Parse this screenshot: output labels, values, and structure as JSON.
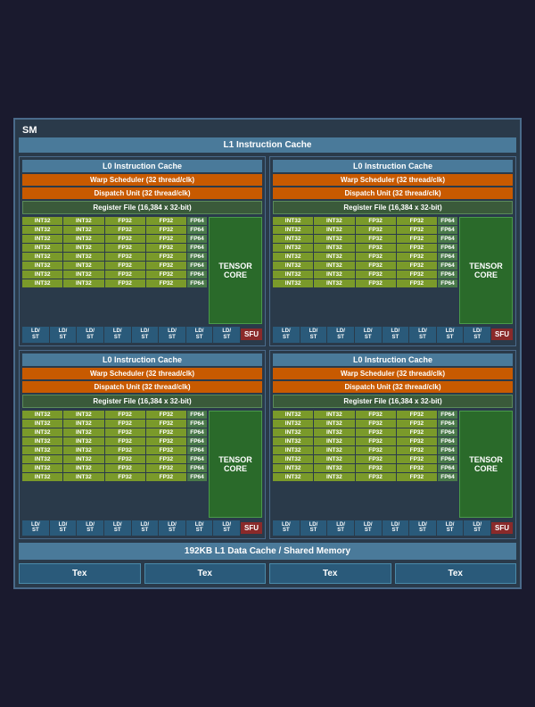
{
  "sm": {
    "label": "SM",
    "l1_instruction_cache": "L1 Instruction Cache",
    "quadrants": [
      {
        "id": "q1",
        "l0_cache": "L0 Instruction Cache",
        "warp_scheduler": "Warp Scheduler (32 thread/clk)",
        "dispatch_unit": "Dispatch Unit (32 thread/clk)",
        "register_file": "Register File (16,384 x 32-bit)",
        "tensor_core": "TENSOR CORE",
        "rows": [
          [
            "INT32",
            "INT32",
            "FP32",
            "FP32",
            "FP64"
          ],
          [
            "INT32",
            "INT32",
            "FP32",
            "FP32",
            "FP64"
          ],
          [
            "INT32",
            "INT32",
            "FP32",
            "FP32",
            "FP64"
          ],
          [
            "INT32",
            "INT32",
            "FP32",
            "FP32",
            "FP64"
          ],
          [
            "INT32",
            "INT32",
            "FP32",
            "FP32",
            "FP64"
          ],
          [
            "INT32",
            "INT32",
            "FP32",
            "FP32",
            "FP64"
          ],
          [
            "INT32",
            "INT32",
            "FP32",
            "FP32",
            "FP64"
          ],
          [
            "INT32",
            "INT32",
            "FP32",
            "FP32",
            "FP64"
          ]
        ],
        "ld_st_count": 8,
        "sfu": "SFU"
      },
      {
        "id": "q2",
        "l0_cache": "L0 Instruction Cache",
        "warp_scheduler": "Warp Scheduler (32 thread/clk)",
        "dispatch_unit": "Dispatch Unit (32 thread/clk)",
        "register_file": "Register File (16,384 x 32-bit)",
        "tensor_core": "TENSOR CORE",
        "rows": [
          [
            "INT32",
            "INT32",
            "FP32",
            "FP32",
            "FP64"
          ],
          [
            "INT32",
            "INT32",
            "FP32",
            "FP32",
            "FP64"
          ],
          [
            "INT32",
            "INT32",
            "FP32",
            "FP32",
            "FP64"
          ],
          [
            "INT32",
            "INT32",
            "FP32",
            "FP32",
            "FP64"
          ],
          [
            "INT32",
            "INT32",
            "FP32",
            "FP32",
            "FP64"
          ],
          [
            "INT32",
            "INT32",
            "FP32",
            "FP32",
            "FP64"
          ],
          [
            "INT32",
            "INT32",
            "FP32",
            "FP32",
            "FP64"
          ],
          [
            "INT32",
            "INT32",
            "FP32",
            "FP32",
            "FP64"
          ]
        ],
        "ld_st_count": 8,
        "sfu": "SFU"
      },
      {
        "id": "q3",
        "l0_cache": "L0 Instruction Cache",
        "warp_scheduler": "Warp Scheduler (32 thread/clk)",
        "dispatch_unit": "Dispatch Unit (32 thread/clk)",
        "register_file": "Register File (16,384 x 32-bit)",
        "tensor_core": "TENSOR CORE",
        "rows": [
          [
            "INT32",
            "INT32",
            "FP32",
            "FP32",
            "FP64"
          ],
          [
            "INT32",
            "INT32",
            "FP32",
            "FP32",
            "FP64"
          ],
          [
            "INT32",
            "INT32",
            "FP32",
            "FP32",
            "FP64"
          ],
          [
            "INT32",
            "INT32",
            "FP32",
            "FP32",
            "FP64"
          ],
          [
            "INT32",
            "INT32",
            "FP32",
            "FP32",
            "FP64"
          ],
          [
            "INT32",
            "INT32",
            "FP32",
            "FP32",
            "FP64"
          ],
          [
            "INT32",
            "INT32",
            "FP32",
            "FP32",
            "FP64"
          ],
          [
            "INT32",
            "INT32",
            "FP32",
            "FP32",
            "FP64"
          ]
        ],
        "ld_st_count": 8,
        "sfu": "SFU"
      },
      {
        "id": "q4",
        "l0_cache": "L0 Instruction Cache",
        "warp_scheduler": "Warp Scheduler (32 thread/clk)",
        "dispatch_unit": "Dispatch Unit (32 thread/clk)",
        "register_file": "Register File (16,384 x 32-bit)",
        "tensor_core": "TENSOR CORE",
        "rows": [
          [
            "INT32",
            "INT32",
            "FP32",
            "FP32",
            "FP64"
          ],
          [
            "INT32",
            "INT32",
            "FP32",
            "FP32",
            "FP64"
          ],
          [
            "INT32",
            "INT32",
            "FP32",
            "FP32",
            "FP64"
          ],
          [
            "INT32",
            "INT32",
            "FP32",
            "FP32",
            "FP64"
          ],
          [
            "INT32",
            "INT32",
            "FP32",
            "FP32",
            "FP64"
          ],
          [
            "INT32",
            "INT32",
            "FP32",
            "FP32",
            "FP64"
          ],
          [
            "INT32",
            "INT32",
            "FP32",
            "FP32",
            "FP64"
          ],
          [
            "INT32",
            "INT32",
            "FP32",
            "FP32",
            "FP64"
          ]
        ],
        "ld_st_count": 8,
        "sfu": "SFU"
      }
    ],
    "l1_data_cache": "192KB L1 Data Cache / Shared Memory",
    "tex_units": [
      "Tex",
      "Tex",
      "Tex",
      "Tex"
    ]
  }
}
